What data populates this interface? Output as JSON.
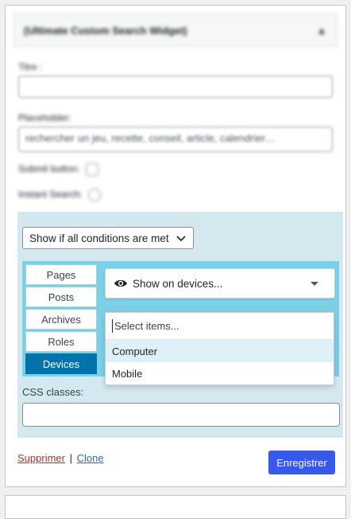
{
  "widget": {
    "title": "(Ultimate Custom Search Widget)",
    "toggle_glyph": "▲",
    "fields": {
      "title_label": "Titre :",
      "placeholder_label": "Placeholder:",
      "placeholder_value": "rechercher un jeu, recette, conseil, article, calendrier…",
      "submit_label": "Submit button:",
      "instant_label": "Instant Search:"
    }
  },
  "rules": {
    "condition_select": "Show if all conditions are met",
    "tabs": [
      "Pages",
      "Posts",
      "Archives",
      "Roles",
      "Devices"
    ],
    "active_tab": "Devices",
    "devices_select": "Show on devices...",
    "dropdown": {
      "placeholder": "Select items...",
      "options": [
        "Computer",
        "Mobile"
      ],
      "highlighted": "Computer"
    },
    "css_label": "CSS classes:"
  },
  "actions": {
    "delete": "Supprimer",
    "separator": "|",
    "clone": "Clone",
    "save": "Enregistrer"
  },
  "colors": {
    "panel_bg": "#d3e8ef",
    "tabs_bg": "#7dcfe6",
    "active_tab": "#0073aa",
    "save_button": "#3858e9",
    "delete_link": "#b32d2e",
    "clone_link": "#2271b1"
  }
}
